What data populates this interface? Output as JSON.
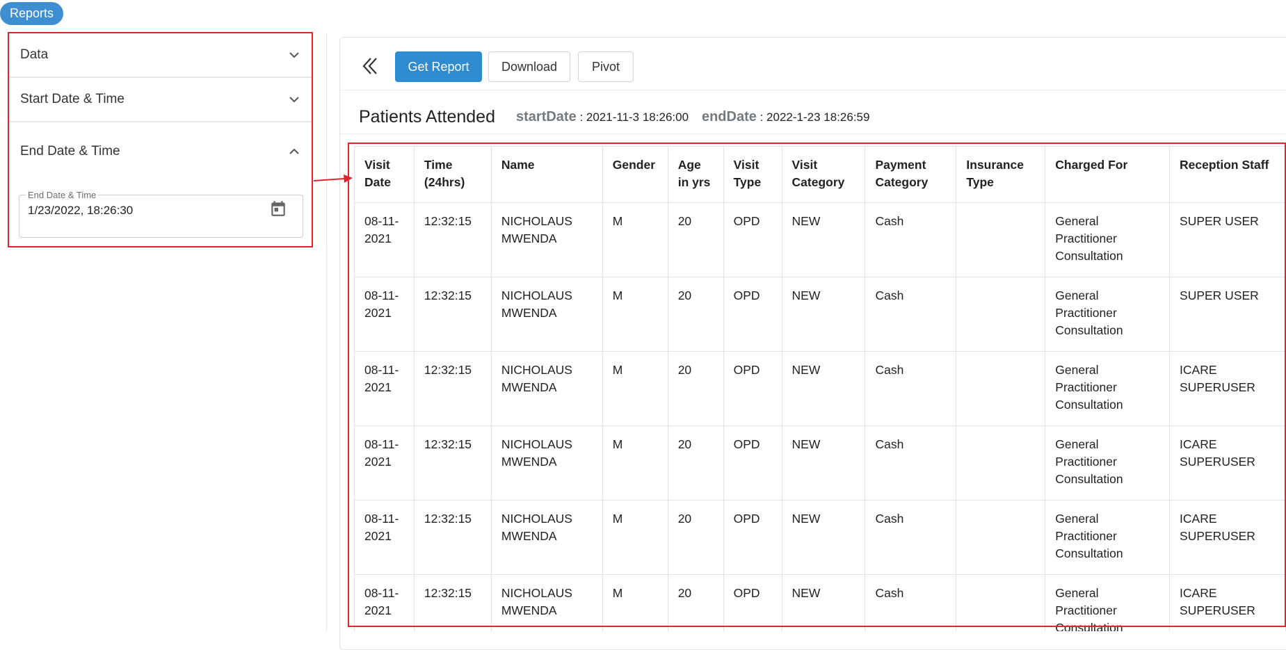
{
  "app": {
    "reports_label": "Reports"
  },
  "sidebar": {
    "sections": [
      {
        "label": "Data",
        "expanded": false
      },
      {
        "label": "Start Date & Time",
        "expanded": false
      },
      {
        "label": "End Date & Time",
        "expanded": true
      }
    ],
    "end_date": {
      "label": "End Date & Time",
      "value": "1/23/2022, 18:26:30"
    }
  },
  "toolbar": {
    "get_report_label": "Get Report",
    "download_label": "Download",
    "pivot_label": "Pivot"
  },
  "report": {
    "title": "Patients Attended",
    "start_key": "startDate",
    "start_value": "2021-11-3 18:26:00",
    "end_key": "endDate",
    "end_value": "2022-1-23 18:26:59"
  },
  "table": {
    "columns": [
      "Visit Date",
      "Time (24hrs)",
      "Name",
      "Gender",
      "Age in yrs",
      "Visit Type",
      "Visit Category",
      "Payment Category",
      "Insurance Type",
      "Charged For",
      "Reception Staff"
    ],
    "rows": [
      [
        "08-11-2021",
        "12:32:15",
        "NICHOLAUS MWENDA",
        "M",
        "20",
        "OPD",
        "NEW",
        "Cash",
        "",
        "General Practitioner Consultation",
        "SUPER USER"
      ],
      [
        "08-11-2021",
        "12:32:15",
        "NICHOLAUS MWENDA",
        "M",
        "20",
        "OPD",
        "NEW",
        "Cash",
        "",
        "General Practitioner Consultation",
        "SUPER USER"
      ],
      [
        "08-11-2021",
        "12:32:15",
        "NICHOLAUS MWENDA",
        "M",
        "20",
        "OPD",
        "NEW",
        "Cash",
        "",
        "General Practitioner Consultation",
        "ICARE SUPERUSER"
      ],
      [
        "08-11-2021",
        "12:32:15",
        "NICHOLAUS MWENDA",
        "M",
        "20",
        "OPD",
        "NEW",
        "Cash",
        "",
        "General Practitioner Consultation",
        "ICARE SUPERUSER"
      ],
      [
        "08-11-2021",
        "12:32:15",
        "NICHOLAUS MWENDA",
        "M",
        "20",
        "OPD",
        "NEW",
        "Cash",
        "",
        "General Practitioner Consultation",
        "ICARE SUPERUSER"
      ],
      [
        "08-11-2021",
        "12:32:15",
        "NICHOLAUS MWENDA",
        "M",
        "20",
        "OPD",
        "NEW",
        "Cash",
        "",
        "General Practitioner Consultation",
        "ICARE SUPERUSER"
      ]
    ]
  },
  "colors": {
    "primary": "#2f8bd0",
    "annotation": "#e0242b"
  }
}
